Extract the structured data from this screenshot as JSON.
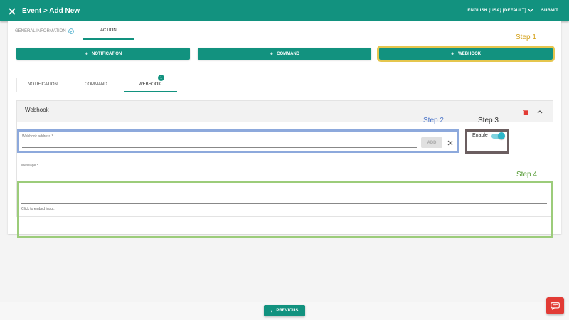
{
  "appbar": {
    "title": "Event > Add New",
    "language": "ENGLISH (USA) [DEFAULT]",
    "submit_label": "SUBMIT",
    "close_icon": "close-icon",
    "color": "#12927f"
  },
  "wizard_steps": [
    {
      "label": "GENERAL INFORMATION",
      "completed": true
    },
    {
      "label": "ACTION",
      "active": true
    }
  ],
  "action_buttons": [
    {
      "label": "NOTIFICATION"
    },
    {
      "label": "COMMAND"
    },
    {
      "label": "WEBHOOK"
    }
  ],
  "annotations": {
    "step1": {
      "label": "Step 1",
      "color": "#d4a017"
    },
    "step2": {
      "label": "Step 2",
      "color": "#4a74c9"
    },
    "step3": {
      "label": "Step 3",
      "color": "#333333"
    },
    "step4": {
      "label": "Step 4",
      "color": "#5a9e3a"
    }
  },
  "subtabs": [
    {
      "label": "NOTIFICATION"
    },
    {
      "label": "COMMAND"
    },
    {
      "label": "WEBHOOK",
      "active": true,
      "badge": "1"
    }
  ],
  "webhook_panel": {
    "title": "Webhook",
    "address_label": "Webhook address *",
    "address_value": "",
    "add_label": "ADD",
    "enable_label": "Enable",
    "enabled": true,
    "message_label": "Message *",
    "message_value": "",
    "hint": "Click to embed input."
  },
  "footer": {
    "previous_label": "PREVIOUS"
  },
  "colors": {
    "primary": "#12927f",
    "danger": "#e23b35"
  }
}
